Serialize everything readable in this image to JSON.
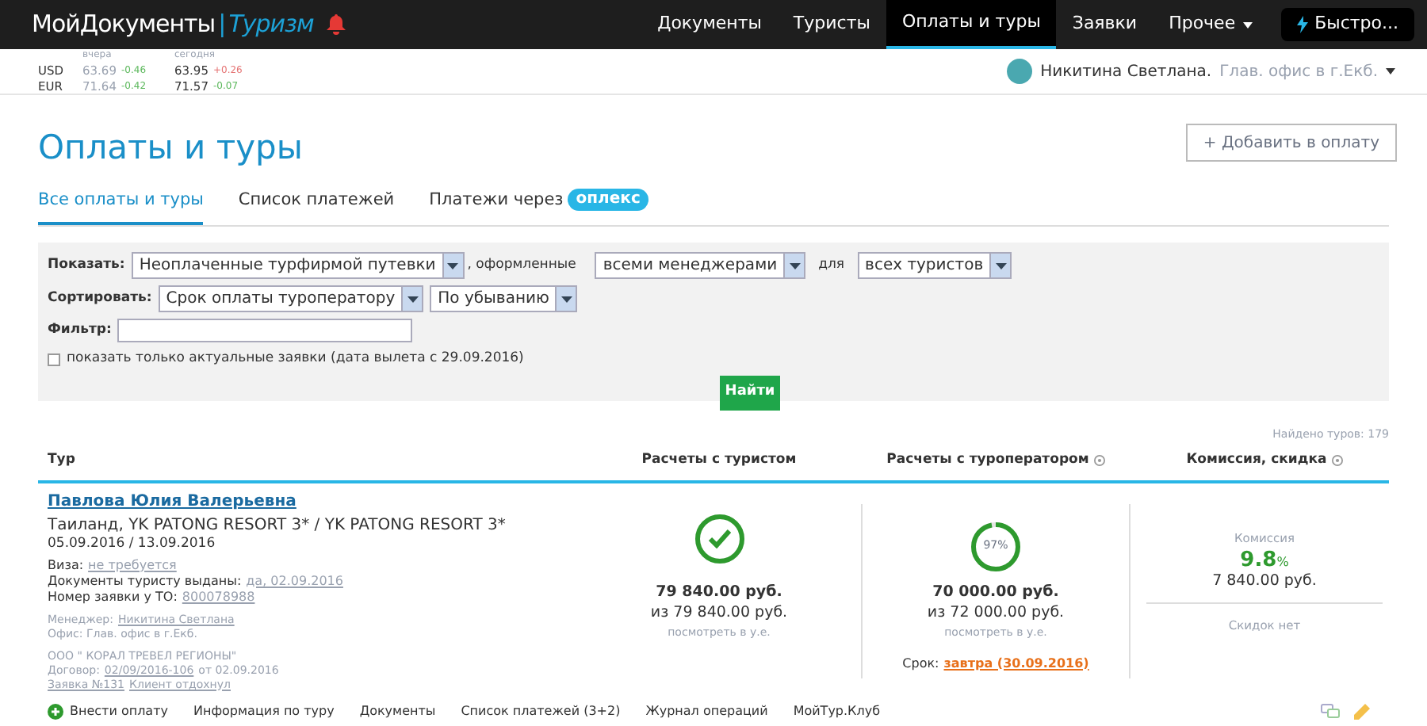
{
  "header": {
    "logo": {
      "main": "МойДокументы",
      "separator": "|",
      "sub": "Туризм"
    },
    "nav": [
      {
        "label": "Документы",
        "selected": false,
        "dropdown": false
      },
      {
        "label": "Туристы",
        "selected": false,
        "dropdown": false
      },
      {
        "label": "Оплаты и туры",
        "selected": true,
        "dropdown": false
      },
      {
        "label": "Заявки",
        "selected": false,
        "dropdown": false
      },
      {
        "label": "Прочее",
        "selected": false,
        "dropdown": true
      }
    ],
    "quick_button": "Быстро..."
  },
  "rates": {
    "yesterday_label": "вчера",
    "today_label": "сегодня",
    "rows": [
      {
        "currency": "USD",
        "values": [
          {
            "value": "63.69",
            "change": "-0.46",
            "color": "#5cb85c"
          },
          {
            "value": "63.95",
            "change": "+0.26",
            "color": "#e57373"
          }
        ]
      },
      {
        "currency": "EUR",
        "values": [
          {
            "value": "71.64",
            "change": "-0.42",
            "color": "#5cb85c"
          },
          {
            "value": "71.57",
            "change": "-0.07",
            "color": "#5cb85c"
          }
        ]
      }
    ]
  },
  "user": {
    "name": "Никитина Светлана.",
    "office": "Глав. офис в г.Екб."
  },
  "page_title": "Оплаты и туры",
  "add_button": "+ Добавить в оплату",
  "tabs": [
    {
      "label": "Все оплаты и туры",
      "selected": true
    },
    {
      "label": "Список платежей",
      "selected": false
    },
    {
      "label": "Платежи через",
      "badge": "оплекс",
      "selected": false
    }
  ],
  "filters": {
    "show_label": "Показать:",
    "show_value": "Неоплаченные турфирмой путевки",
    "issued_text": ", оформленные",
    "manager_value": "всеми менеджерами",
    "for_text": "для",
    "tourist_value": "всех туристов",
    "sort_label": "Сортировать:",
    "sort_value": "Срок оплаты туроператору",
    "order_value": "По убыванию",
    "filter_label": "Фильтр:",
    "actual_only": {
      "label": "показать только актуальные заявки (дата вылета с 29.09.2016)",
      "checked": false
    },
    "find_button": "Найти"
  },
  "found": "Найдено туров: 179",
  "table": {
    "columns": [
      {
        "label": "Тур",
        "help": false
      },
      {
        "label": "Расчеты с туристом",
        "help": false
      },
      {
        "label": "Расчеты с туроператором",
        "help": true
      },
      {
        "label": "Комиссия, скидка",
        "help": true
      }
    ],
    "rows": [
      {
        "tourist": "Павлова Юлия Валерьевна",
        "hotel": "Таиланд, YK PATONG RESORT 3* / YK PATONG RESORT 3*",
        "dates": "05.09.2016 / 13.09.2016",
        "details": [
          {
            "label": "Виза:",
            "value": "не требуется"
          },
          {
            "label": "Документы туристу выданы:",
            "value": "да, 02.09.2016"
          },
          {
            "label": "Номер заявки у ТО:",
            "value": "800078988"
          }
        ],
        "manager_label": "Менеджер:",
        "manager": "Никитина Светлана",
        "office": "Офис: Глав. офис в г.Екб.",
        "operator": "ООО \" КОРАЛ ТРЕВЕЛ РЕГИОНЫ\"",
        "contract_label": "Договор:",
        "contract": "02/09/2016-106",
        "contract_date": "от 02.09.2016",
        "order_link": "Заявка №131",
        "client_link": "Клиент отдохнул",
        "tourist_pay": {
          "level": 1,
          "paid": "79 840.00 руб.",
          "total": "из 79 840.00 руб.",
          "currency_link": "посмотреть в у.е."
        },
        "operator_pay": {
          "level": 0.97,
          "percent": "97%",
          "paid": "70 000.00 руб.",
          "total": "из 72 000.00 руб.",
          "currency_link": "посмотреть в у.е.",
          "due_label": "Срок:",
          "due": "завтра (30.09.2016)"
        },
        "commission": {
          "label": "Комиссия",
          "percent": "9.8",
          "unit": "%",
          "amount": "7 840.00 руб.",
          "discount": "Скидок нет"
        },
        "actions": [
          {
            "label": "Внести оплату",
            "kind": "add"
          },
          {
            "label": "Информация по туру",
            "kind": "link"
          },
          {
            "label": "Документы",
            "kind": "link"
          },
          {
            "label": "Список платежей (3+2)",
            "kind": "link"
          },
          {
            "label": "Журнал операций",
            "kind": "link"
          },
          {
            "label": "МойТур.Клуб",
            "kind": "link"
          }
        ]
      }
    ]
  }
}
